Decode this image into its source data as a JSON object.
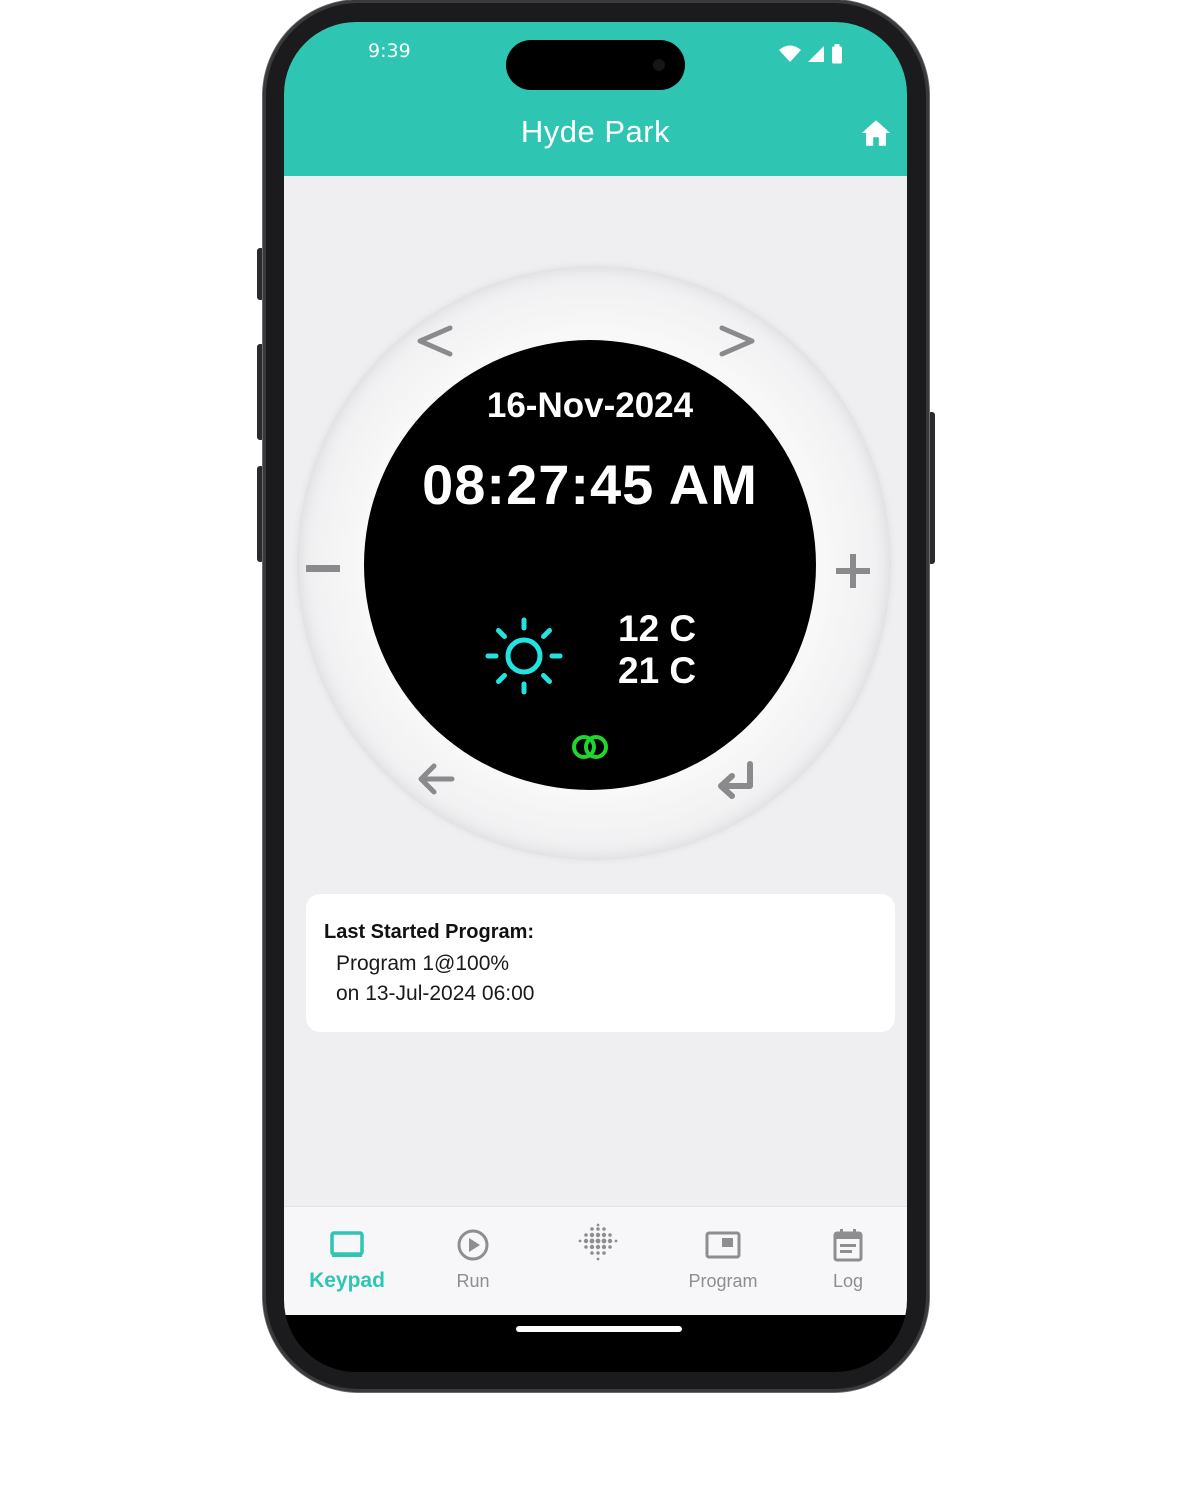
{
  "status_bar": {
    "time": "9:39"
  },
  "header": {
    "title": "Hyde Park",
    "home_icon": "home-icon"
  },
  "colors": {
    "accent": "#2ec6b2",
    "background": "#efeef1",
    "display": "#000000",
    "sun": "#21e3e0",
    "link": "#1ed62e"
  },
  "display": {
    "date": "16-Nov-2024",
    "time": "08:27:45 AM",
    "temp_low": "12 C",
    "temp_high": "21 C",
    "weather_icon": "sun-icon",
    "connection_icon": "link-rings-icon"
  },
  "dial_buttons": {
    "prev": "<",
    "next": ">",
    "minus": "−",
    "plus": "+",
    "back_icon": "back-arrow-icon",
    "enter_icon": "enter-icon"
  },
  "last_program": {
    "heading": "Last Started Program:",
    "program": "Program 1@100%",
    "date": "on 13-Jul-2024 06:00"
  },
  "tabs": [
    {
      "label": "Keypad",
      "icon": "keypad-icon",
      "active": true
    },
    {
      "label": "Run",
      "icon": "play-icon",
      "active": false
    },
    {
      "label": "",
      "icon": "dot-grid-icon",
      "active": false
    },
    {
      "label": "Program",
      "icon": "program-icon",
      "active": false
    },
    {
      "label": "Log",
      "icon": "calendar-icon",
      "active": false
    }
  ]
}
